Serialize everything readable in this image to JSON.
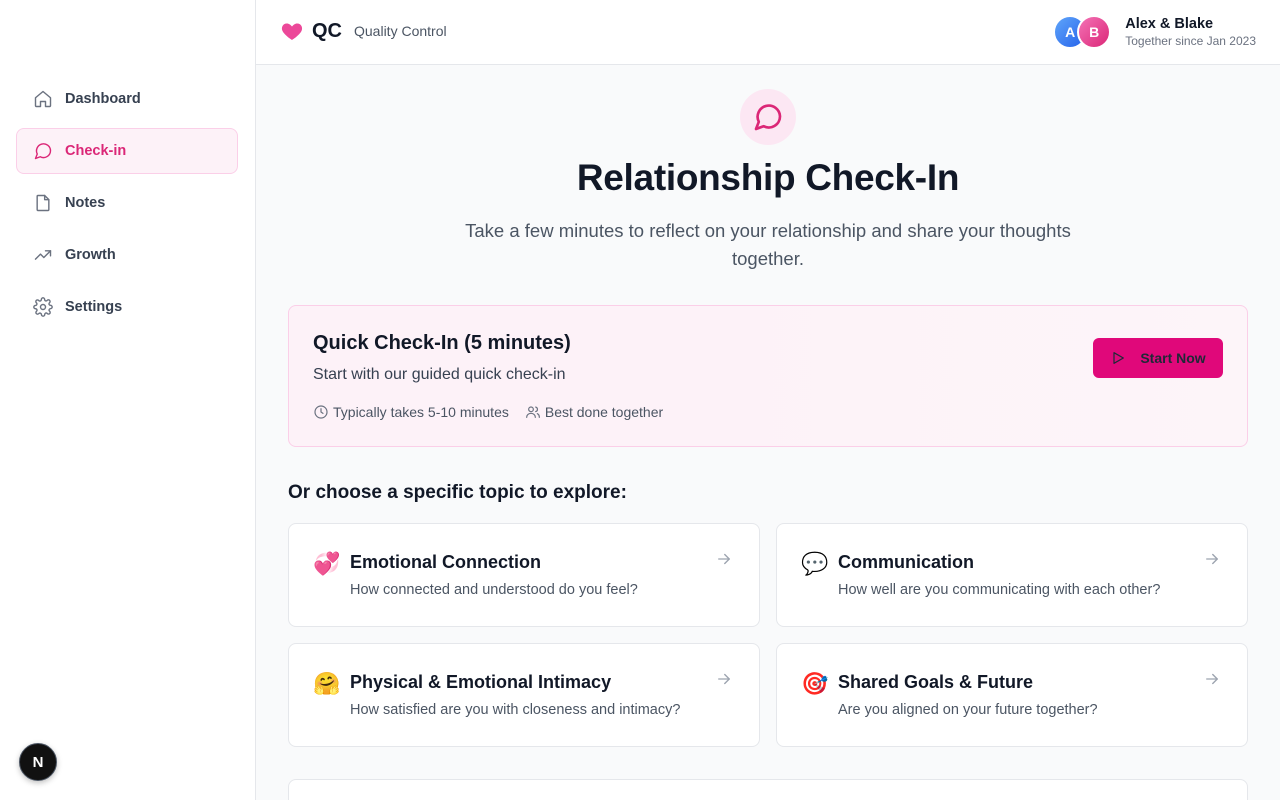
{
  "brand": {
    "logo_text": "QC",
    "tagline": "Quality Control",
    "accent_color": "#db2777"
  },
  "user": {
    "avatar_a": "A",
    "avatar_b": "B",
    "names": "Alex & Blake",
    "since": "Together since Jan 2023"
  },
  "sidebar": {
    "items": [
      {
        "label": "Dashboard",
        "icon": "home-icon",
        "active": false
      },
      {
        "label": "Check-in",
        "icon": "message-circle-icon",
        "active": true
      },
      {
        "label": "Notes",
        "icon": "file-icon",
        "active": false
      },
      {
        "label": "Growth",
        "icon": "trending-up-icon",
        "active": false
      },
      {
        "label": "Settings",
        "icon": "gear-icon",
        "active": false
      }
    ],
    "badge": "N"
  },
  "main": {
    "title": "Relationship Check-In",
    "subtitle": "Take a few minutes to reflect on your relationship and share your thoughts together.",
    "quick": {
      "title": "Quick Check-In (5 minutes)",
      "description": "Start with our guided quick check-in",
      "duration": "Typically takes 5-10 minutes",
      "together": "Best done together",
      "button": "Start Now"
    },
    "topics_heading": "Or choose a specific topic to explore:",
    "topics": [
      {
        "emoji": "💞",
        "title": "Emotional Connection",
        "description": "How connected and understood do you feel?"
      },
      {
        "emoji": "💬",
        "title": "Communication",
        "description": "How well are you communicating with each other?"
      },
      {
        "emoji": "🤗",
        "title": "Physical & Emotional Intimacy",
        "description": "How satisfied are you with closeness and intimacy?"
      },
      {
        "emoji": "🎯",
        "title": "Shared Goals & Future",
        "description": "Are you aligned on your future together?"
      }
    ]
  }
}
